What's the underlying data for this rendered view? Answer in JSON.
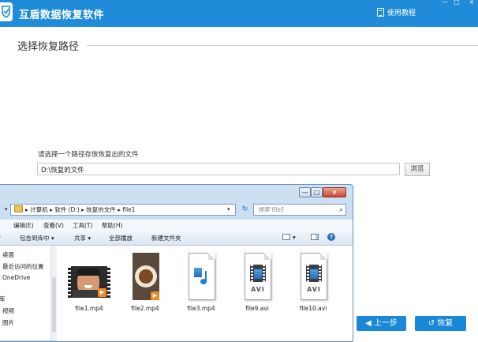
{
  "app": {
    "title": "互盾数据恢复软件",
    "help_label": "使用教程",
    "window_controls": {
      "minimize": "—",
      "maximize": "□",
      "close": "×"
    }
  },
  "section": {
    "title": "选择恢复路径"
  },
  "path": {
    "label": "请选择一个路径存放恢复出的文件",
    "value": "D:\\恢复的文件",
    "browse_label": "浏览"
  },
  "explorer": {
    "window_controls": {
      "minimize": "—",
      "maximize": "□",
      "close": "×"
    },
    "address": [
      "计算机",
      "软件 (D:)",
      "恢复的文件",
      "file1"
    ],
    "address_separator": "▸",
    "search_placeholder": "搜索 file1",
    "menus": [
      "编辑(E)",
      "查看(V)",
      "工具(T)",
      "帮助(H)"
    ],
    "toolbar": [
      "包含到库中 ▾",
      "共享 ▾",
      "全部播放",
      "新建文件夹"
    ],
    "nav_items": [
      "桌面",
      "最近访问的位置",
      "OneDrive",
      "库",
      "视频",
      "图片"
    ],
    "files": [
      {
        "name": "file1.mp4",
        "icon": "video-thumbnail-icon"
      },
      {
        "name": "file2.mp4",
        "icon": "video-thumbnail-icon"
      },
      {
        "name": "file3.mp4",
        "icon": "media-file-icon"
      },
      {
        "name": "file9.avi",
        "icon": "avi-file-icon",
        "badge": "AVI"
      },
      {
        "name": "file10.avi",
        "icon": "avi-file-icon",
        "badge": "AVI"
      }
    ]
  },
  "actions": {
    "prev_label": "上一步",
    "recover_label": "恢复"
  },
  "colors": {
    "brand_blue": "#1f8bd9",
    "button_blue": "#1a88d8"
  }
}
